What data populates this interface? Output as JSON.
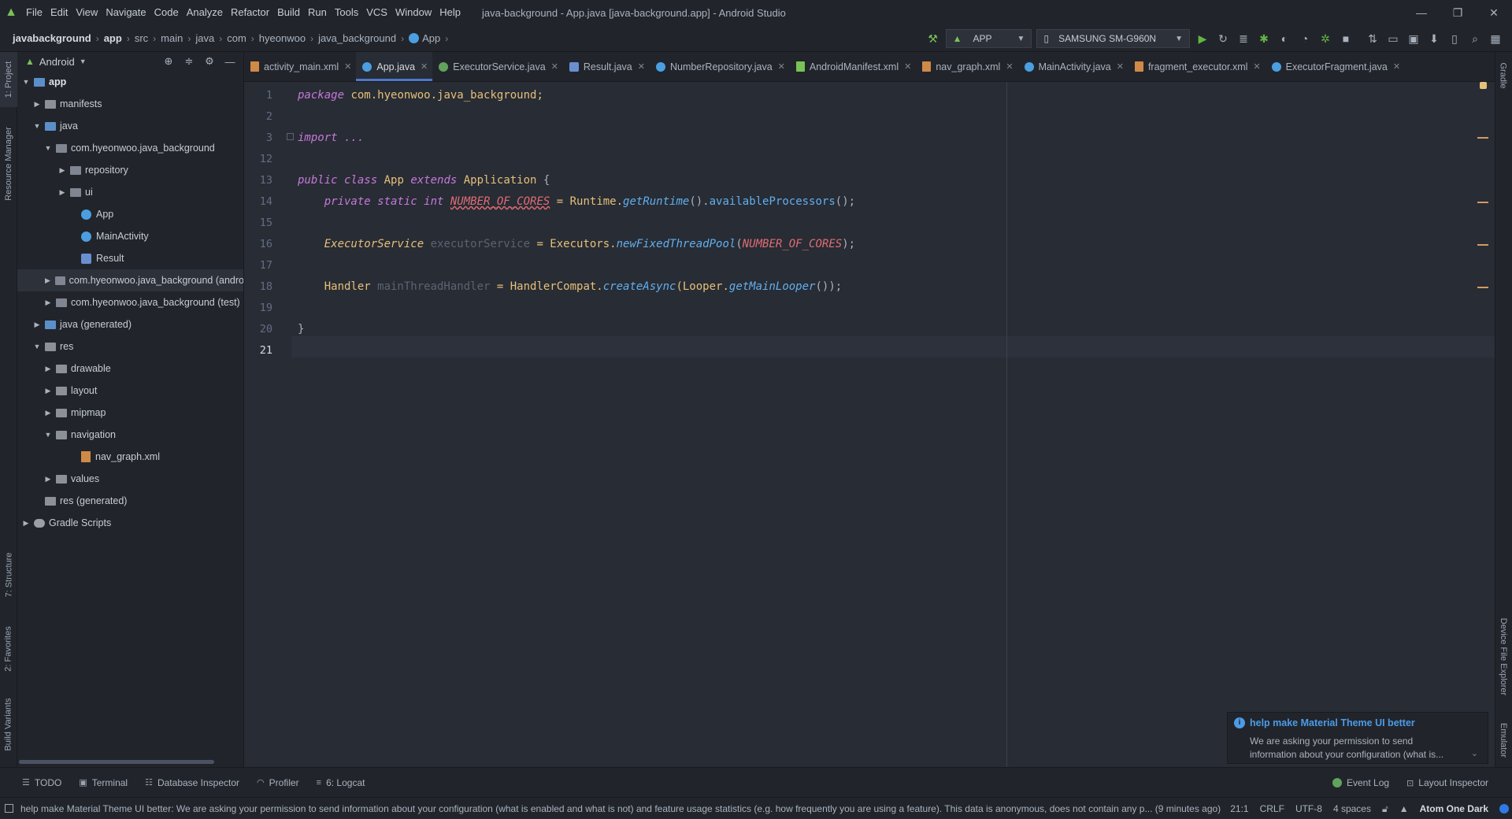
{
  "window": {
    "title": "java-background - App.java [java-background.app] - Android Studio",
    "controls": [
      "minimize",
      "restore",
      "close"
    ]
  },
  "menu": [
    "File",
    "Edit",
    "View",
    "Navigate",
    "Code",
    "Analyze",
    "Refactor",
    "Build",
    "Run",
    "Tools",
    "VCS",
    "Window",
    "Help"
  ],
  "breadcrumb": [
    "javabackground",
    "app",
    "src",
    "main",
    "java",
    "com",
    "hyeonwoo",
    "java_background",
    "App"
  ],
  "toolbar": {
    "run_config": "APP",
    "device": "SAMSUNG SM-G960N"
  },
  "left_strip": {
    "project": "1: Project",
    "resource_manager": "Resource Manager",
    "structure": "7: Structure",
    "favorites": "2: Favorites",
    "build_variants": "Build Variants"
  },
  "right_strip": {
    "gradle": "Gradle",
    "device_file_explorer": "Device File Explorer",
    "emulator": "Emulator"
  },
  "project_panel": {
    "view": "Android",
    "tree": [
      {
        "label": "app"
      },
      {
        "label": "manifests"
      },
      {
        "label": "java"
      },
      {
        "label": "com.hyeonwoo.java_background"
      },
      {
        "label": "repository"
      },
      {
        "label": "ui"
      },
      {
        "label": "App"
      },
      {
        "label": "MainActivity"
      },
      {
        "label": "Result"
      },
      {
        "label": "com.hyeonwoo.java_background (andro"
      },
      {
        "label": "com.hyeonwoo.java_background (test)"
      },
      {
        "label": "java (generated)"
      },
      {
        "label": "res"
      },
      {
        "label": "drawable"
      },
      {
        "label": "layout"
      },
      {
        "label": "mipmap"
      },
      {
        "label": "navigation"
      },
      {
        "label": "nav_graph.xml"
      },
      {
        "label": "values"
      },
      {
        "label": "res (generated)"
      },
      {
        "label": "Gradle Scripts"
      }
    ]
  },
  "tabs": [
    {
      "label": "activity_main.xml"
    },
    {
      "label": "App.java"
    },
    {
      "label": "ExecutorService.java"
    },
    {
      "label": "Result.java"
    },
    {
      "label": "NumberRepository.java"
    },
    {
      "label": "AndroidManifest.xml"
    },
    {
      "label": "nav_graph.xml"
    },
    {
      "label": "MainActivity.java"
    },
    {
      "label": "fragment_executor.xml"
    },
    {
      "label": "ExecutorFragment.java"
    }
  ],
  "editor": {
    "line_numbers": [
      "1",
      "2",
      "3",
      "12",
      "13",
      "14",
      "15",
      "16",
      "17",
      "18",
      "19",
      "20",
      "21"
    ],
    "code": {
      "l1_kw": "package",
      "l1_rest": " com.hyeonwoo.java_background;",
      "l3": "import ...",
      "l13_kw1": "public class",
      "l13_name": " App ",
      "l13_kw2": "extends",
      "l13_super": " Application",
      "l13_brace": " {",
      "l14_kw": "    private static int",
      "l14_const": "NUMBER_OF_CORES",
      "l14_eq": " = Runtime.",
      "l14_fn": "getRuntime",
      "l14_mid": "().",
      "l14_mth": "availableProcessors",
      "l14_end": "();",
      "l16_type": "    ExecutorService",
      "l16_var": " executorService",
      "l16_eq": " = Executors.",
      "l16_fn": "newFixedThreadPool",
      "l16_open": "(",
      "l16_const": "NUMBER_OF_CORES",
      "l16_end": ");",
      "l18_type": "    Handler",
      "l18_var": " mainThreadHandler",
      "l18_eq": " = HandlerCompat.",
      "l18_fn": "createAsync",
      "l18_mid": "(Looper.",
      "l18_fn2": "getMainLooper",
      "l18_end": "());",
      "l20": "}"
    }
  },
  "notification": {
    "title": "help make Material Theme UI better",
    "body": "We are asking your permission to send information about your configuration (what is..."
  },
  "bottom_tools": {
    "todo": "TODO",
    "terminal": "Terminal",
    "database_inspector": "Database Inspector",
    "profiler": "Profiler",
    "logcat": "6: Logcat",
    "event_log": "Event Log",
    "layout_inspector": "Layout Inspector"
  },
  "status": {
    "message": "help make Material Theme UI better: We are asking your permission to send information about your configuration (what is enabled and what is not) and feature usage statistics (e.g. how frequently you are using a feature). This data is anonymous, does not contain any p... (9 minutes ago)",
    "position": "21:1",
    "line_sep": "CRLF",
    "encoding": "UTF-8",
    "indent": "4 spaces",
    "theme": "Atom One Dark"
  },
  "colors": {
    "background": "#21252b",
    "editor_bg": "#282c34",
    "accent": "#4d78cc",
    "keyword": "#c678dd",
    "type": "#e5c07b",
    "function": "#61afef",
    "constant": "#e06c75"
  }
}
